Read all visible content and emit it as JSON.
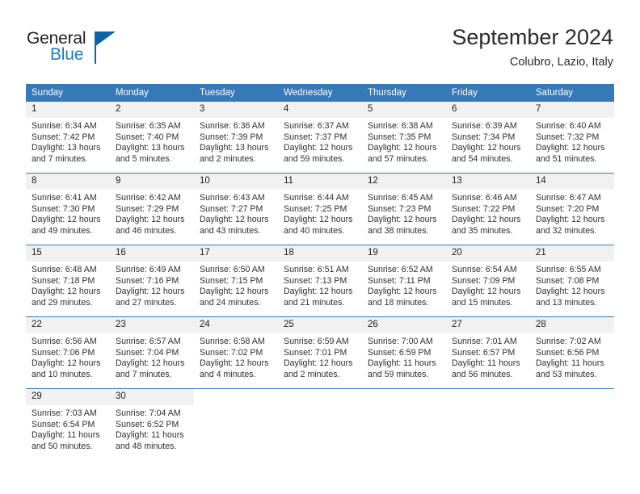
{
  "brand": {
    "name_part1": "General",
    "name_part2": "Blue",
    "triangle_icon": "triangle-logo-mark"
  },
  "header": {
    "title": "September 2024",
    "subtitle": "Colubro, Lazio, Italy"
  },
  "colors": {
    "header_blue": "#3679b9",
    "daynum_band": "#f1f1f1",
    "logo_blue": "#1f7bc1",
    "logo_dark": "#231f20",
    "text": "#2f2f2f"
  },
  "weekday_headers": [
    "Sunday",
    "Monday",
    "Tuesday",
    "Wednesday",
    "Thursday",
    "Friday",
    "Saturday"
  ],
  "labels": {
    "sunrise_prefix": "Sunrise:",
    "sunset_prefix": "Sunset:",
    "daylight_prefix": "Daylight:"
  },
  "weeks": [
    [
      {
        "day": "1",
        "sunrise": "Sunrise: 6:34 AM",
        "sunset": "Sunset: 7:42 PM",
        "daylight": "Daylight: 13 hours and 7 minutes."
      },
      {
        "day": "2",
        "sunrise": "Sunrise: 6:35 AM",
        "sunset": "Sunset: 7:40 PM",
        "daylight": "Daylight: 13 hours and 5 minutes."
      },
      {
        "day": "3",
        "sunrise": "Sunrise: 6:36 AM",
        "sunset": "Sunset: 7:39 PM",
        "daylight": "Daylight: 13 hours and 2 minutes."
      },
      {
        "day": "4",
        "sunrise": "Sunrise: 6:37 AM",
        "sunset": "Sunset: 7:37 PM",
        "daylight": "Daylight: 12 hours and 59 minutes."
      },
      {
        "day": "5",
        "sunrise": "Sunrise: 6:38 AM",
        "sunset": "Sunset: 7:35 PM",
        "daylight": "Daylight: 12 hours and 57 minutes."
      },
      {
        "day": "6",
        "sunrise": "Sunrise: 6:39 AM",
        "sunset": "Sunset: 7:34 PM",
        "daylight": "Daylight: 12 hours and 54 minutes."
      },
      {
        "day": "7",
        "sunrise": "Sunrise: 6:40 AM",
        "sunset": "Sunset: 7:32 PM",
        "daylight": "Daylight: 12 hours and 51 minutes."
      }
    ],
    [
      {
        "day": "8",
        "sunrise": "Sunrise: 6:41 AM",
        "sunset": "Sunset: 7:30 PM",
        "daylight": "Daylight: 12 hours and 49 minutes."
      },
      {
        "day": "9",
        "sunrise": "Sunrise: 6:42 AM",
        "sunset": "Sunset: 7:29 PM",
        "daylight": "Daylight: 12 hours and 46 minutes."
      },
      {
        "day": "10",
        "sunrise": "Sunrise: 6:43 AM",
        "sunset": "Sunset: 7:27 PM",
        "daylight": "Daylight: 12 hours and 43 minutes."
      },
      {
        "day": "11",
        "sunrise": "Sunrise: 6:44 AM",
        "sunset": "Sunset: 7:25 PM",
        "daylight": "Daylight: 12 hours and 40 minutes."
      },
      {
        "day": "12",
        "sunrise": "Sunrise: 6:45 AM",
        "sunset": "Sunset: 7:23 PM",
        "daylight": "Daylight: 12 hours and 38 minutes."
      },
      {
        "day": "13",
        "sunrise": "Sunrise: 6:46 AM",
        "sunset": "Sunset: 7:22 PM",
        "daylight": "Daylight: 12 hours and 35 minutes."
      },
      {
        "day": "14",
        "sunrise": "Sunrise: 6:47 AM",
        "sunset": "Sunset: 7:20 PM",
        "daylight": "Daylight: 12 hours and 32 minutes."
      }
    ],
    [
      {
        "day": "15",
        "sunrise": "Sunrise: 6:48 AM",
        "sunset": "Sunset: 7:18 PM",
        "daylight": "Daylight: 12 hours and 29 minutes."
      },
      {
        "day": "16",
        "sunrise": "Sunrise: 6:49 AM",
        "sunset": "Sunset: 7:16 PM",
        "daylight": "Daylight: 12 hours and 27 minutes."
      },
      {
        "day": "17",
        "sunrise": "Sunrise: 6:50 AM",
        "sunset": "Sunset: 7:15 PM",
        "daylight": "Daylight: 12 hours and 24 minutes."
      },
      {
        "day": "18",
        "sunrise": "Sunrise: 6:51 AM",
        "sunset": "Sunset: 7:13 PM",
        "daylight": "Daylight: 12 hours and 21 minutes."
      },
      {
        "day": "19",
        "sunrise": "Sunrise: 6:52 AM",
        "sunset": "Sunset: 7:11 PM",
        "daylight": "Daylight: 12 hours and 18 minutes."
      },
      {
        "day": "20",
        "sunrise": "Sunrise: 6:54 AM",
        "sunset": "Sunset: 7:09 PM",
        "daylight": "Daylight: 12 hours and 15 minutes."
      },
      {
        "day": "21",
        "sunrise": "Sunrise: 6:55 AM",
        "sunset": "Sunset: 7:08 PM",
        "daylight": "Daylight: 12 hours and 13 minutes."
      }
    ],
    [
      {
        "day": "22",
        "sunrise": "Sunrise: 6:56 AM",
        "sunset": "Sunset: 7:06 PM",
        "daylight": "Daylight: 12 hours and 10 minutes."
      },
      {
        "day": "23",
        "sunrise": "Sunrise: 6:57 AM",
        "sunset": "Sunset: 7:04 PM",
        "daylight": "Daylight: 12 hours and 7 minutes."
      },
      {
        "day": "24",
        "sunrise": "Sunrise: 6:58 AM",
        "sunset": "Sunset: 7:02 PM",
        "daylight": "Daylight: 12 hours and 4 minutes."
      },
      {
        "day": "25",
        "sunrise": "Sunrise: 6:59 AM",
        "sunset": "Sunset: 7:01 PM",
        "daylight": "Daylight: 12 hours and 2 minutes."
      },
      {
        "day": "26",
        "sunrise": "Sunrise: 7:00 AM",
        "sunset": "Sunset: 6:59 PM",
        "daylight": "Daylight: 11 hours and 59 minutes."
      },
      {
        "day": "27",
        "sunrise": "Sunrise: 7:01 AM",
        "sunset": "Sunset: 6:57 PM",
        "daylight": "Daylight: 11 hours and 56 minutes."
      },
      {
        "day": "28",
        "sunrise": "Sunrise: 7:02 AM",
        "sunset": "Sunset: 6:56 PM",
        "daylight": "Daylight: 11 hours and 53 minutes."
      }
    ],
    [
      {
        "day": "29",
        "sunrise": "Sunrise: 7:03 AM",
        "sunset": "Sunset: 6:54 PM",
        "daylight": "Daylight: 11 hours and 50 minutes."
      },
      {
        "day": "30",
        "sunrise": "Sunrise: 7:04 AM",
        "sunset": "Sunset: 6:52 PM",
        "daylight": "Daylight: 11 hours and 48 minutes."
      },
      {
        "day": "",
        "sunrise": "",
        "sunset": "",
        "daylight": ""
      },
      {
        "day": "",
        "sunrise": "",
        "sunset": "",
        "daylight": ""
      },
      {
        "day": "",
        "sunrise": "",
        "sunset": "",
        "daylight": ""
      },
      {
        "day": "",
        "sunrise": "",
        "sunset": "",
        "daylight": ""
      },
      {
        "day": "",
        "sunrise": "",
        "sunset": "",
        "daylight": ""
      }
    ]
  ]
}
